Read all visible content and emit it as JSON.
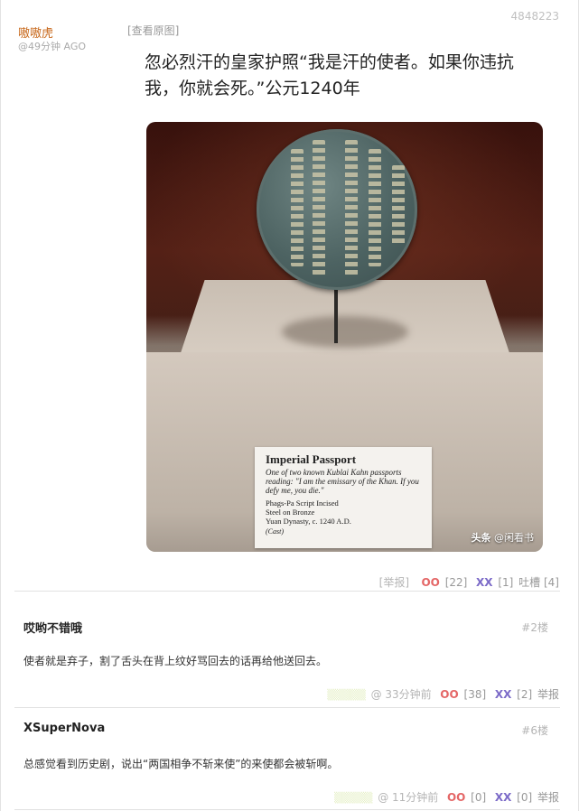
{
  "post": {
    "id": "4848223",
    "author": "嗷嗷虎",
    "time": "@49分钟 AGO",
    "view_original": "[查看原图]",
    "text": "忽必烈汗的皇家护照“我是汗的使者。如果你违抗我，你就会死。”公元1240年",
    "image": {
      "label_title": "Imperial Passport",
      "label_desc": "One of two known Kublai Kahn passports reading: \"I am the emissary of the Khan. If you defy me, you die.\"",
      "label_meta_1": "Phags-Pa Script Incised",
      "label_meta_2": "Steel on Bronze",
      "label_meta_3": "Yuan Dynasty, c. 1240 A.D.",
      "label_cast": "(Cast)",
      "watermark_brand": "头条",
      "watermark_user": "@闲看书"
    },
    "actions": {
      "report": "[举报]",
      "oo": "OO",
      "oo_count": "[22]",
      "xx": "XX",
      "xx_count": "[1]",
      "tucao": "吐槽 [4]"
    }
  },
  "comments": [
    {
      "author": "哎哟不错哦",
      "floor": "#2楼",
      "text": "使者就是弃子，割了舌头在背上纹好骂回去的话再给他送回去。",
      "time": "@ 33分钟前",
      "oo": "OO",
      "oo_count": "[38]",
      "xx": "XX",
      "xx_count": "[2]",
      "report": "举报"
    },
    {
      "author": "XSuperNova",
      "floor": "#6楼",
      "text": "总感觉看到历史剧，说出“两国相争不斩来使”的来使都会被斩啊。",
      "time": "@ 11分钟前",
      "oo": "OO",
      "oo_count": "[0]",
      "xx": "XX",
      "xx_count": "[0]",
      "report": "举报"
    }
  ],
  "colors": {
    "author": "#c8691c",
    "oo": "#e46666",
    "xx": "#7b6ac8"
  }
}
